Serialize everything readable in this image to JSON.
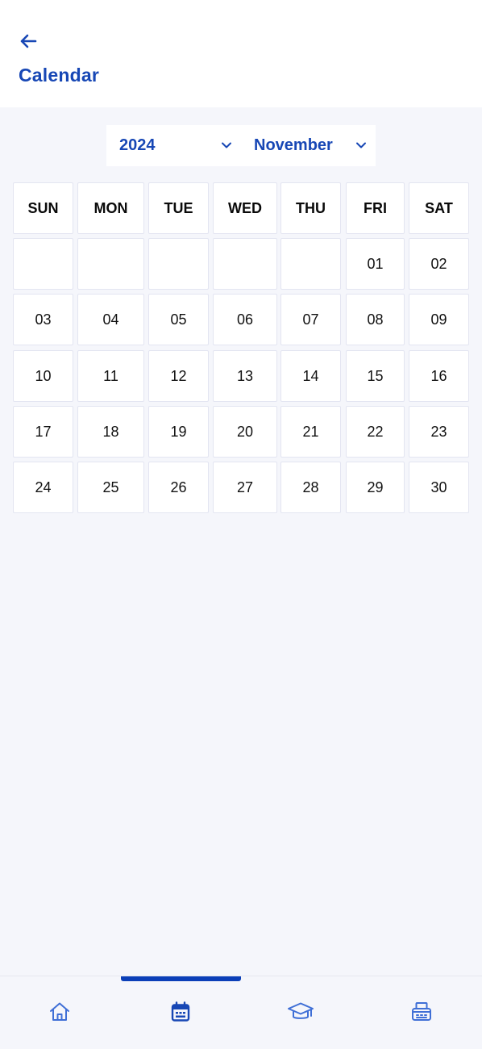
{
  "header": {
    "title": "Calendar",
    "back_icon": "arrow-left-icon"
  },
  "pickers": {
    "year": "2024",
    "month": "November"
  },
  "calendar": {
    "weekdays": [
      "SUN",
      "MON",
      "TUE",
      "WED",
      "THU",
      "FRI",
      "SAT"
    ],
    "weeks": [
      [
        "",
        "",
        "",
        "",
        "",
        "01",
        "02"
      ],
      [
        "03",
        "04",
        "05",
        "06",
        "07",
        "08",
        "09"
      ],
      [
        "10",
        "11",
        "12",
        "13",
        "14",
        "15",
        "16"
      ],
      [
        "17",
        "18",
        "19",
        "20",
        "21",
        "22",
        "23"
      ],
      [
        "24",
        "25",
        "26",
        "27",
        "28",
        "29",
        "30"
      ]
    ]
  },
  "nav": {
    "items": [
      {
        "icon": "home-icon"
      },
      {
        "icon": "calendar-icon",
        "active": true
      },
      {
        "icon": "graduation-cap-icon"
      },
      {
        "icon": "fax-printer-icon"
      }
    ]
  },
  "colors": {
    "accent": "#1747b5",
    "nav_icon": "#3f6fd6",
    "background": "#f5f6fb"
  }
}
